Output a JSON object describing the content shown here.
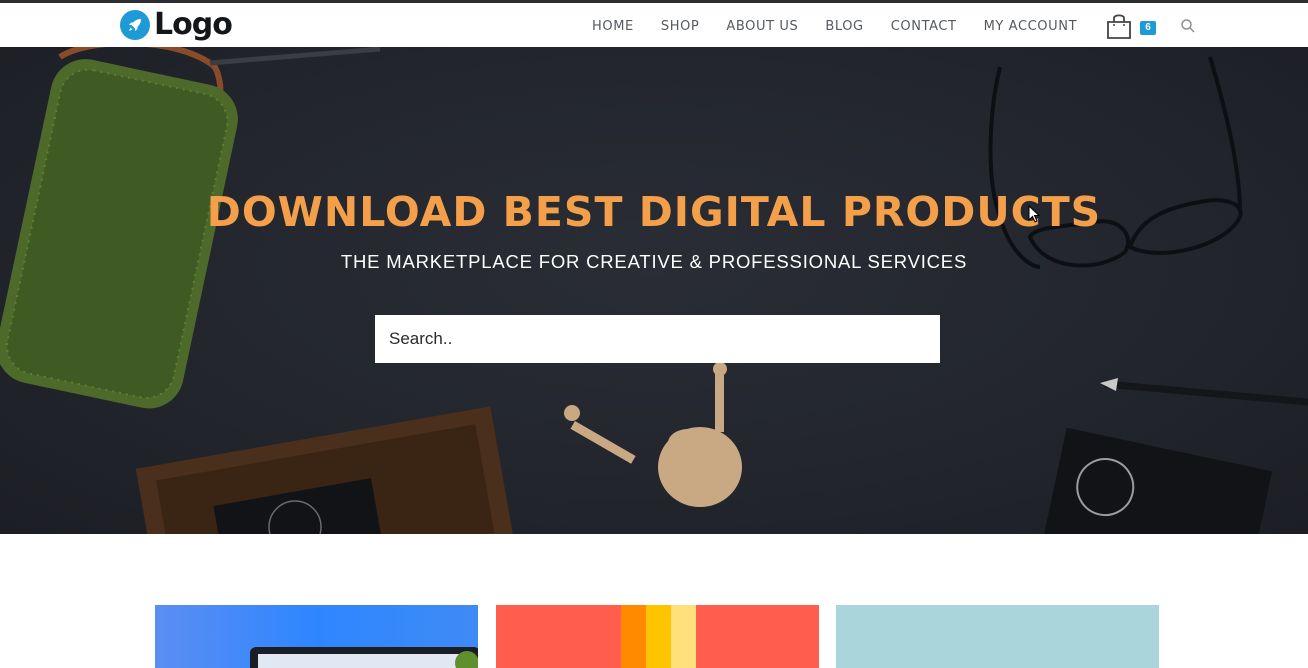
{
  "header": {
    "logo_text": "Logo",
    "nav": [
      {
        "label": "HOME"
      },
      {
        "label": "SHOP"
      },
      {
        "label": "ABOUT US"
      },
      {
        "label": "BLOG"
      },
      {
        "label": "CONTACT"
      },
      {
        "label": "MY ACCOUNT"
      }
    ],
    "cart_count": "6"
  },
  "hero": {
    "title": "DOWNLOAD BEST DIGITAL PRODUCTS",
    "subtitle": "THE MARKETPLACE FOR CREATIVE & PROFESSIONAL SERVICES",
    "search_placeholder": "Search.."
  },
  "icons": {
    "logo": "rocket-icon",
    "cart": "shopping-bag-icon",
    "search": "search-icon"
  },
  "colors": {
    "accent": "#1e9bd6",
    "hero_title": "#f4a04a",
    "hero_bg": "#23262d",
    "card_1": "#2e86ff",
    "card_2": "#ff5e4e",
    "card_3": "#a9d6da"
  }
}
